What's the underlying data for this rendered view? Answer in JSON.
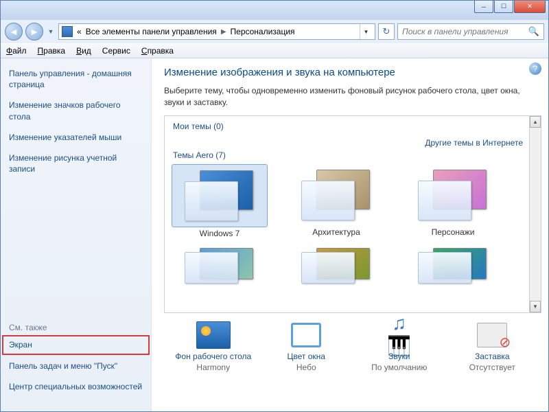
{
  "breadcrumb": {
    "root": "«",
    "level1": "Все элементы панели управления",
    "level2": "Персонализация"
  },
  "search": {
    "placeholder": "Поиск в панели управления"
  },
  "menubar": {
    "file": "Файл",
    "edit": "Правка",
    "view": "Вид",
    "tools": "Сервис",
    "help": "Справка"
  },
  "sidebar": {
    "home": "Панель управления - домашняя страница",
    "links": [
      "Изменение значков рабочего стола",
      "Изменение указателей мыши",
      "Изменение рисунка учетной записи"
    ],
    "see_also_label": "См. также",
    "see_also": [
      "Экран",
      "Панель задач и меню \"Пуск\"",
      "Центр специальных возможностей"
    ]
  },
  "main": {
    "title": "Изменение изображения и звука на компьютере",
    "subtitle": "Выберите тему, чтобы одновременно изменить фоновый рисунок рабочего стола, цвет окна, звуки и заставку.",
    "my_themes": "Мои темы (0)",
    "internet_link": "Другие темы в Интернете",
    "aero_label": "Темы Aero (7)",
    "themes": [
      "Windows 7",
      "Архитектура",
      "Персонажи"
    ]
  },
  "footer": {
    "items": [
      {
        "label": "Фон рабочего стола",
        "value": "Harmony"
      },
      {
        "label": "Цвет окна",
        "value": "Небо"
      },
      {
        "label": "Звуки",
        "value": "По умолчанию"
      },
      {
        "label": "Заставка",
        "value": "Отсутствует"
      }
    ]
  }
}
